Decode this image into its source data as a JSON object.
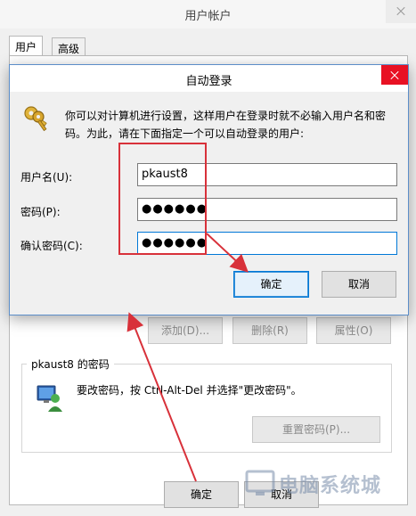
{
  "background_window": {
    "title": "用户帐户",
    "tabs": [
      {
        "label": "用户",
        "active": true
      },
      {
        "label": "高级",
        "active": false
      }
    ],
    "buttons": {
      "add": "添加(D)...",
      "remove": "删除(R)",
      "properties": "属性(O)"
    },
    "password_group": {
      "legend": "pkaust8 的密码",
      "instruction": "要改密码，按 Ctrl-Alt-Del 并选择\"更改密码\"。",
      "reset_button": "重置密码(P)..."
    },
    "bottom_buttons": {
      "ok": "确定",
      "cancel_partial": "取消"
    }
  },
  "dialog": {
    "title": "自动登录",
    "description": "你可以对计算机进行设置，这样用户在登录时就不必输入用户名和密码。为此，请在下面指定一个可以自动登录的用户:",
    "fields": {
      "username_label": "用户名(U):",
      "username_value": "pkaust8",
      "password_label": "密码(P):",
      "password_value": "●●●●●●",
      "confirm_label": "确认密码(C):",
      "confirm_value": "●●●●●●"
    },
    "buttons": {
      "ok": "确定",
      "cancel": "取消"
    }
  },
  "annotation_color": "#d8313a",
  "watermark_text": "电脑系统城"
}
